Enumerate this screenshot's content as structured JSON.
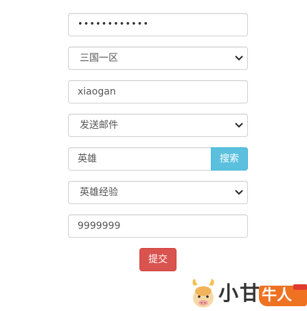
{
  "form": {
    "password": {
      "value": "••••••••••••"
    },
    "server_select": {
      "selected": "三国一区"
    },
    "username": {
      "value": "xiaogan"
    },
    "action_select": {
      "selected": "发送邮件"
    },
    "search": {
      "value": "英雄",
      "button_label": "搜索"
    },
    "category_select": {
      "selected": "英雄经验"
    },
    "amount": {
      "value": "9999999"
    },
    "submit_label": "提交"
  },
  "watermark": {
    "logo": "小甘牛人"
  },
  "colors": {
    "search_button": "#5bc0de",
    "submit_button": "#d9534f",
    "watermark_badge": "#ee7222"
  }
}
